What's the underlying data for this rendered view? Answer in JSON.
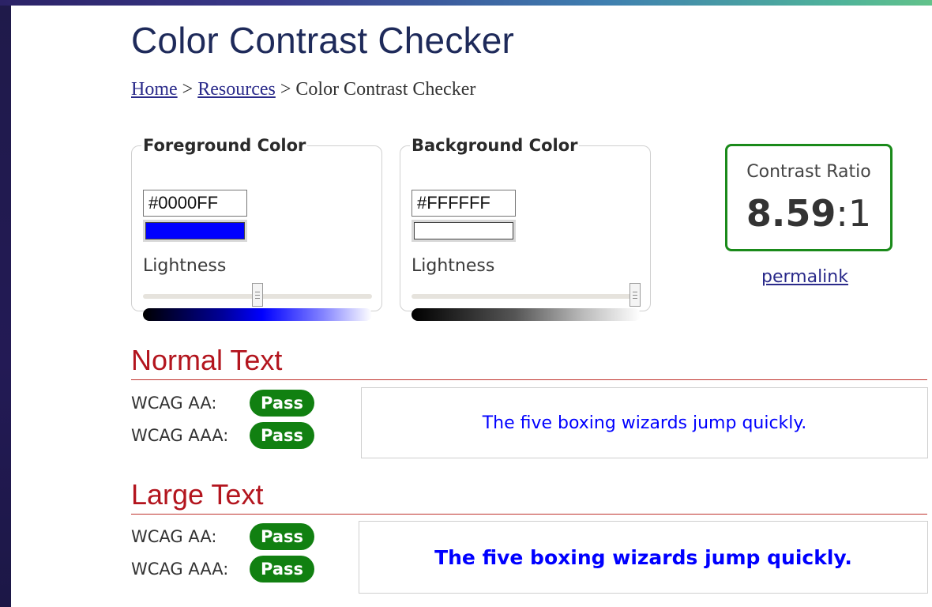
{
  "page": {
    "title": "Color Contrast Checker"
  },
  "breadcrumb": {
    "home": "Home",
    "sep1": ">",
    "resources": "Resources",
    "sep2": ">",
    "current": "Color Contrast Checker"
  },
  "foreground": {
    "legend": "Foreground Color",
    "hex": "#0000FF",
    "swatch_color": "#0000FF",
    "lightness_label": "Lightness",
    "lightness_value": 0.5
  },
  "background": {
    "legend": "Background Color",
    "hex": "#FFFFFF",
    "swatch_color": "#FFFFFF",
    "lightness_label": "Lightness",
    "lightness_value": 1.0
  },
  "contrast": {
    "label": "Contrast Ratio",
    "value": "8.59",
    "suffix": ":1"
  },
  "permalink": "permalink",
  "normal_text": {
    "heading": "Normal Text",
    "aa_label": "WCAG AA:",
    "aa_result": "Pass",
    "aaa_label": "WCAG AAA:",
    "aaa_result": "Pass",
    "sample": "The five boxing wizards jump quickly."
  },
  "large_text": {
    "heading": "Large Text",
    "aa_label": "WCAG AA:",
    "aa_result": "Pass",
    "aaa_label": "WCAG AAA:",
    "aaa_result": "Pass",
    "sample": "The five boxing wizards jump quickly."
  },
  "colors": {
    "pass": "#118011",
    "heading": "#b3151e",
    "sample_text": "#0000FF",
    "ratio_border": "#1a8a1a"
  }
}
